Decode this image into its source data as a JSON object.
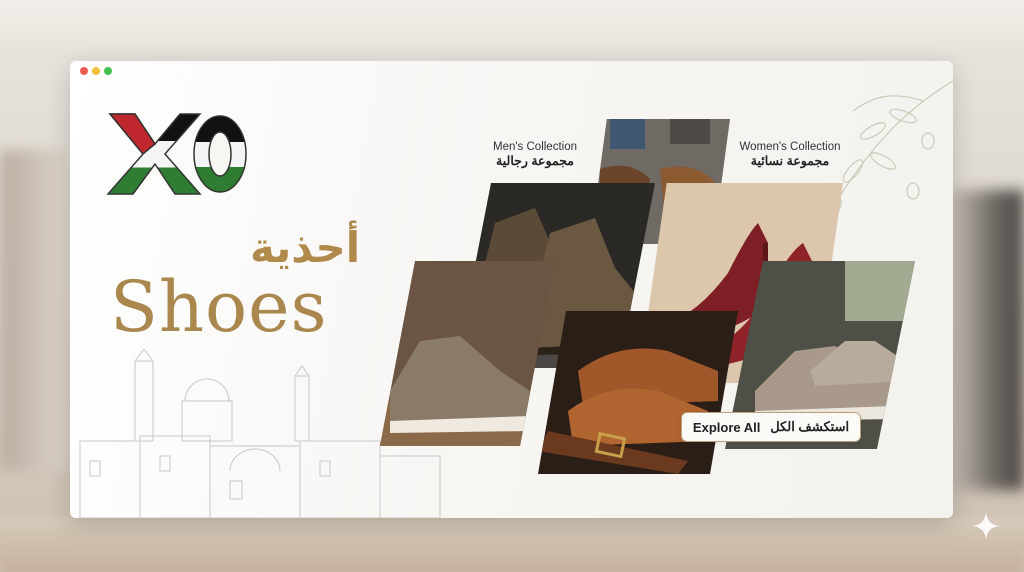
{
  "brand": {
    "logo_text": "XO"
  },
  "hero": {
    "title_ar": "أحذية",
    "title_en": "Shoes"
  },
  "collections": [
    {
      "label_en": "Men's Collection",
      "label_ar": "مجموعة رجالية"
    },
    {
      "label_en": "Women's Collection",
      "label_ar": "مجموعة نسائية"
    }
  ],
  "cta": {
    "label_en": "Explore All",
    "label_ar": "استكشف الكل"
  },
  "icons": {
    "sparkle": "sparkle-icon",
    "window_dots": [
      "close-dot",
      "minimize-dot",
      "maximize-dot"
    ]
  },
  "colors": {
    "gold": "#a9874d",
    "flag_red": "#c0262d",
    "flag_green": "#2e7d32",
    "flag_black": "#111111"
  }
}
